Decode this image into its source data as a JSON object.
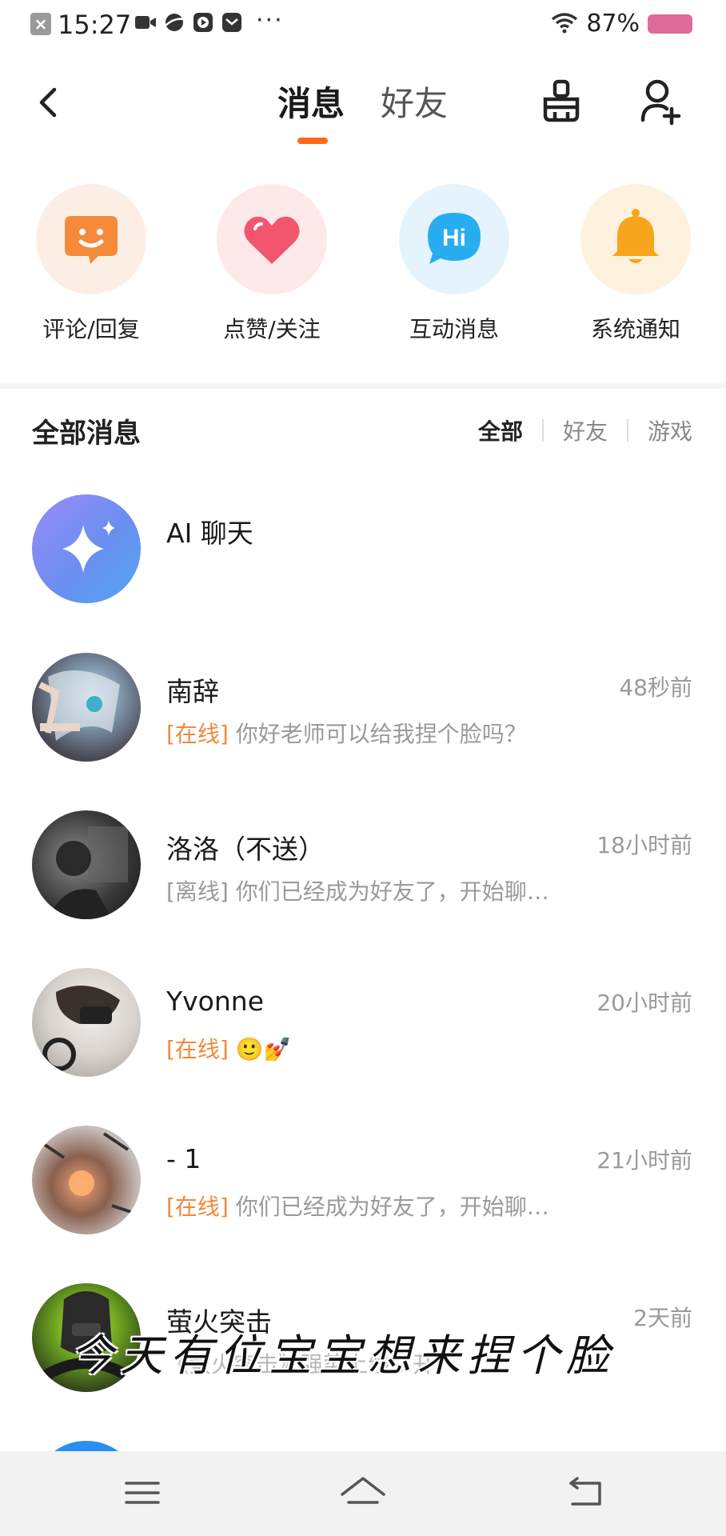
{
  "status_bar": {
    "time": "15:27",
    "dots": "···",
    "battery": "87%",
    "battery_color": "#e06a9a"
  },
  "header": {
    "tabs": [
      {
        "label": "消息",
        "active": true
      },
      {
        "label": "好友",
        "active": false
      }
    ],
    "accent_color": "#ff6a1a"
  },
  "quick_actions": [
    {
      "label": "评论/回复",
      "icon": "smile-chat-icon",
      "bg": "#fdeee5"
    },
    {
      "label": "点赞/关注",
      "icon": "heart-icon",
      "bg": "#fde9e9"
    },
    {
      "label": "互动消息",
      "icon": "hi-bubble-icon",
      "bg": "#e5f3fc"
    },
    {
      "label": "系统通知",
      "icon": "bell-icon",
      "bg": "#fef1de"
    }
  ],
  "messages_section": {
    "title": "全部消息",
    "filters": [
      {
        "label": "全部",
        "active": true
      },
      {
        "label": "好友",
        "active": false
      },
      {
        "label": "游戏",
        "active": false
      }
    ]
  },
  "conversations": [
    {
      "name": "AI 聊天",
      "time": "",
      "status": "",
      "status_type": "",
      "preview": ""
    },
    {
      "name": "南辞",
      "time": "48秒前",
      "status": "[在线]",
      "status_type": "online",
      "preview": "你好老师可以给我捏个脸吗？"
    },
    {
      "name": "洛洛（不送）",
      "time": "18小时前",
      "status": "[离线]",
      "status_type": "offline",
      "preview": "你们已经成为好友了，开始聊…"
    },
    {
      "name": "Yvonne",
      "time": "20小时前",
      "status": "[在线]",
      "status_type": "online",
      "preview": "🙂💅"
    },
    {
      "name": "- 1",
      "time": "21小时前",
      "status": "[在线]",
      "status_type": "online",
      "preview": "你们已经成为好友了，开始聊…"
    },
    {
      "name": "萤火突击",
      "time": "2天前",
      "status": "",
      "status_type": "",
      "preview": "《萤火突击》强势上线…开"
    }
  ],
  "caption": "今天有位宝宝想来捏个脸"
}
